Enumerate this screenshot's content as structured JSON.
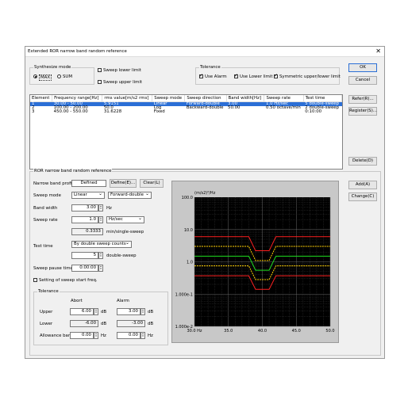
{
  "window": {
    "title": "Extended ROR narrow band random reference",
    "close": "✕"
  },
  "synth": {
    "caption": "Synthesize mode",
    "opt1": "MAX",
    "opt2": "SUM",
    "selected": "MAX",
    "sweep_lower": "Sweep lower limit",
    "sweep_upper": "Sweep upper limit"
  },
  "tolerance_top": {
    "caption": "Tolerance",
    "use_alarm": "Use Alarm",
    "use_lower": "Use Lower limit",
    "symmetric": "Symmetric upper/lower limit"
  },
  "buttons": {
    "ok": "OK",
    "cancel": "Cancel",
    "refer": "Refer(R)...",
    "register": "Register(S)...",
    "delete": "Delete(D)",
    "add": "Add(A)",
    "change": "Change(C)",
    "define": "Define(E)...",
    "clear": "Clear(L)"
  },
  "table": {
    "headers": [
      "Element",
      "Frequency range[Hz]",
      "rms value[m/s2 rms]",
      "Sweep mode",
      "Sweep direction",
      "Band width[Hz]",
      "Sweep rate",
      "Test time"
    ],
    "rows": [
      [
        "1",
        "30.00 - 50.00",
        "5.9151",
        "Linear",
        "Forward-double",
        "3.00",
        "1.0 Hz/sec",
        "5 double-sweep"
      ],
      [
        "2",
        "100.00 - 200.00",
        "50.0",
        "Log",
        "Backward-double",
        "50.00",
        "0.50 octave/min",
        "2 double-sweep"
      ],
      [
        "3",
        "450.00 - 550.00",
        "31.6228",
        "Fixed",
        "",
        "",
        "",
        "0:10:00"
      ]
    ]
  },
  "ror": {
    "caption": "ROR narrow band random reference",
    "profile_label": "Narrow band profile",
    "profile_value": "Defined",
    "sweep_mode_label": "Sweep mode",
    "sweep_mode": "Linear",
    "sweep_dir": "Forward-double",
    "band_width_label": "Band width",
    "band_width": "3.00",
    "hz": "Hz",
    "sweep_rate_label": "Sweep rate",
    "sweep_rate": "1.0",
    "sweep_rate_unit": "Hz/sec",
    "sweep_rate2": "0.3333",
    "sweep_rate2_unit": "min/single-sweep",
    "test_time_label": "Test time",
    "test_time_mode": "By double sweep counts",
    "double_count": "5",
    "double_unit": "double-sweep",
    "pause_label": "Sweep pause time",
    "pause": "0:00:00",
    "start_freq": "Setting of sweep start freq."
  },
  "tol": {
    "caption": "Tolerance",
    "abort": "Abort",
    "alarm": "Alarm",
    "upper": "Upper",
    "lower": "Lower",
    "band": "Allowance band",
    "abort_upper": "6.00",
    "abort_lower": "-6.00",
    "abort_band": "0.00",
    "alarm_upper": "3.00",
    "alarm_lower": "-3.00",
    "alarm_band": "0.00",
    "db": "dB",
    "hz": "Hz"
  },
  "chart_data": {
    "type": "line",
    "title": "",
    "ylabel_unit": "(m/s2)²/Hz",
    "xlim": [
      30,
      50
    ],
    "x_ticks": [
      "30.0 Hz",
      "35.0",
      "40.0",
      "45.0",
      "50.0"
    ],
    "y_log": true,
    "ylim": [
      0.01,
      100
    ],
    "y_ticks": [
      "100.0",
      "10.0",
      "1.0",
      "1.000e-1",
      "1.000e-2"
    ],
    "grid": true,
    "notch_x": [
      30,
      38,
      39,
      41,
      42,
      50
    ],
    "series": [
      {
        "color": "#ff2020",
        "values": [
          6.0,
          6.0,
          2.2,
          2.2,
          6.0,
          6.0
        ]
      },
      {
        "color": "#ffd000",
        "values": [
          3.0,
          3.0,
          1.1,
          1.1,
          3.0,
          3.0
        ]
      },
      {
        "color": "#20e020",
        "values": [
          1.5,
          1.5,
          0.55,
          0.55,
          1.5,
          1.5
        ]
      },
      {
        "color": "#ffd000",
        "values": [
          0.75,
          0.75,
          0.28,
          0.28,
          0.75,
          0.75
        ]
      },
      {
        "color": "#ff2020",
        "values": [
          0.37,
          0.37,
          0.14,
          0.14,
          0.37,
          0.37
        ]
      }
    ]
  }
}
